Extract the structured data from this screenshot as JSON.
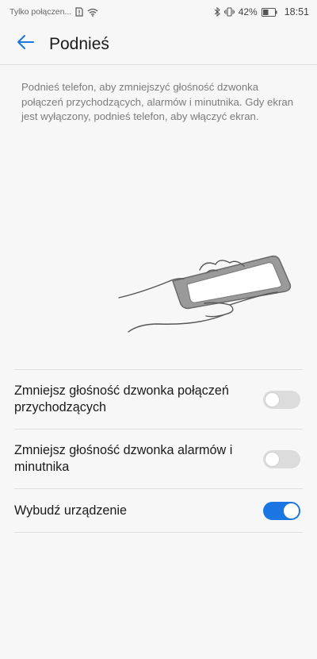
{
  "status_bar": {
    "carrier": "Tylko połączen...",
    "battery_percent": "42%",
    "time": "18:51",
    "icons": [
      "sim-alert-icon",
      "wifi-icon",
      "bluetooth-icon",
      "vibrate-icon",
      "battery-icon"
    ]
  },
  "header": {
    "title": "Podnieś"
  },
  "description": "Podnieś telefon, aby zmniejszyć głośność dzwonka połączeń przychodzących, alarmów i minutnika. Gdy ekran jest wyłączony, podnieś telefon, aby włączyć ekran.",
  "settings": [
    {
      "label": "Zmniejsz głośność dzwonka połączeń przychodzących",
      "enabled": false
    },
    {
      "label": "Zmniejsz głośność dzwonka alarmów i minutnika",
      "enabled": false
    },
    {
      "label": "Wybudź urządzenie",
      "enabled": true
    }
  ],
  "colors": {
    "accent": "#1b76e3",
    "toggle_off": "#dcdcdc",
    "background": "#f7f7f7"
  }
}
